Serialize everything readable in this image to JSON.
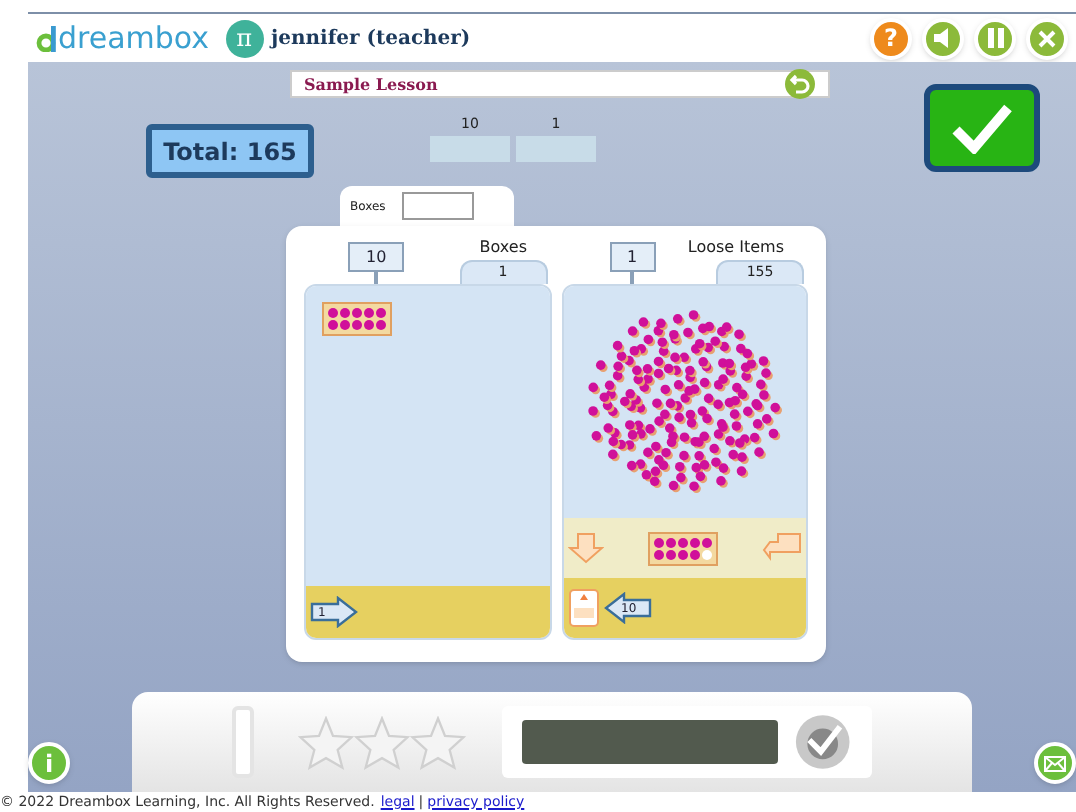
{
  "header": {
    "logo": "dreambox",
    "avatar": "π",
    "user": "jennifer (teacher)",
    "help_button": "?"
  },
  "info_button": "i",
  "banner": {
    "title": "Sample Lesson"
  },
  "total": "Total: 165",
  "place_columns": [
    {
      "label": "10"
    },
    {
      "label": "1"
    }
  ],
  "workspace": {
    "tab_label": "Boxes",
    "boxes_panel": {
      "sign": "10",
      "title": "Boxes",
      "count": "1",
      "arrow_label": "1"
    },
    "loose_panel": {
      "sign": "1",
      "title": "Loose Items",
      "count": "155",
      "arrow_label": "10"
    }
  },
  "score": {
    "stars": 0
  },
  "footer": {
    "copyright": "© 2022 Dreambox Learning, Inc. All Rights Reserved.",
    "links": [
      "legal",
      "privacy policy"
    ],
    "separator": "|"
  }
}
